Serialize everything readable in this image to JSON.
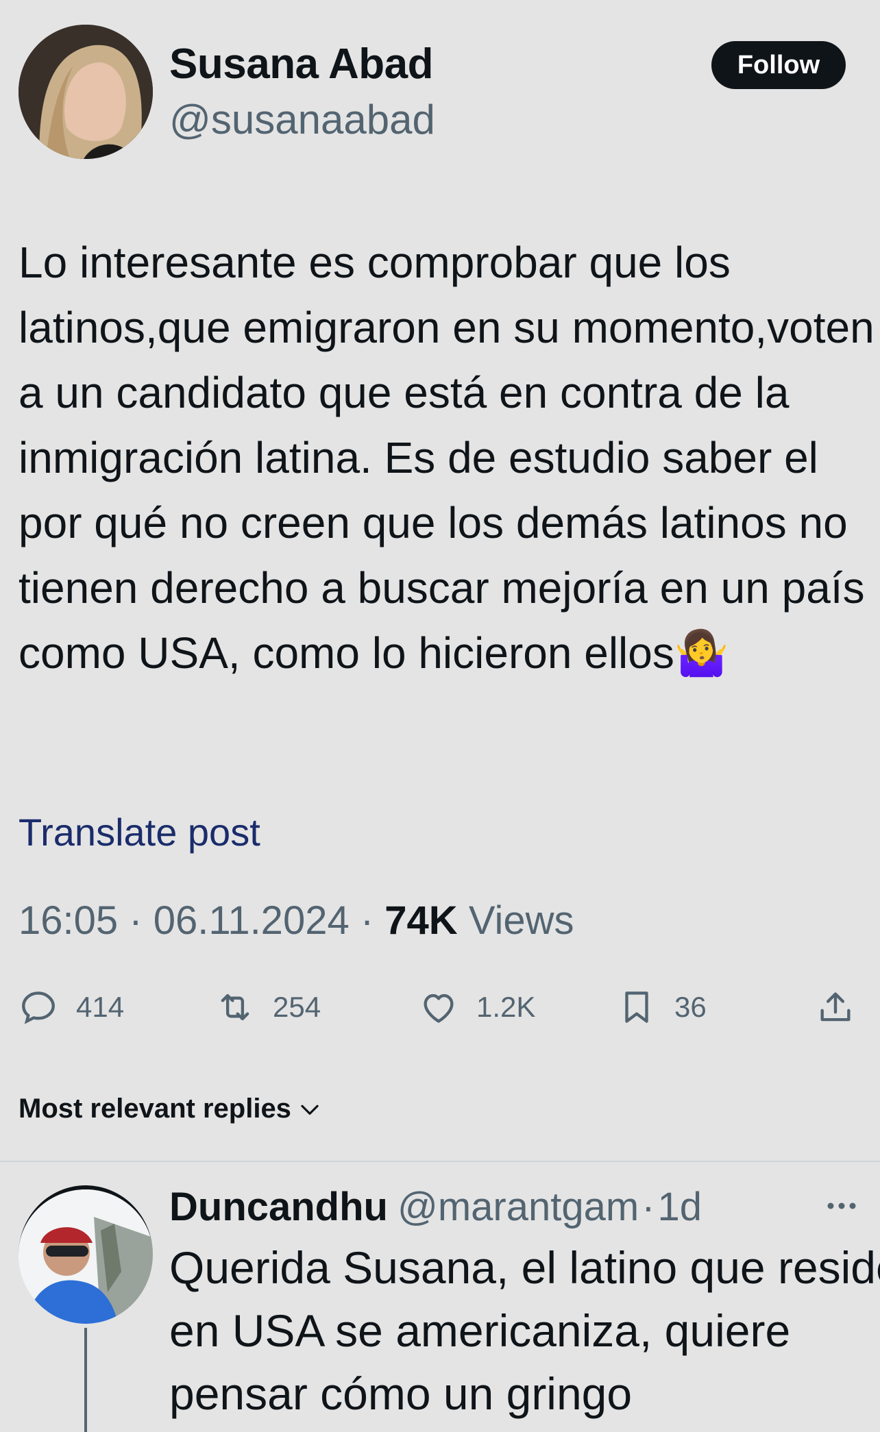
{
  "post": {
    "author": {
      "display_name": "Susana Abad",
      "handle": "@susanaabad",
      "avatar_icon": "profile-photo"
    },
    "follow_label": "Follow",
    "text": "Lo interesante es comprobar que los latinos,que emigraron en su momento,voten a un candidato que está en contra de la inmigración latina. Es de estudio saber el por qué no creen que los demás latinos no tienen derecho a buscar mejoría en un país como USA, como lo hicieron ellos🤷‍♀️",
    "translate_label": "Translate post",
    "time": "16:05",
    "date": "06.11.2024",
    "separator": "·",
    "views_count": "74K",
    "views_label": "Views",
    "actions": {
      "replies": {
        "count": "414",
        "icon": "reply-icon"
      },
      "reposts": {
        "count": "254",
        "icon": "repost-icon"
      },
      "likes": {
        "count": "1.2K",
        "icon": "heart-icon"
      },
      "bookmarks": {
        "count": "36",
        "icon": "bookmark-icon"
      },
      "share": {
        "icon": "share-icon"
      }
    }
  },
  "replies_section": {
    "sort_label": "Most relevant replies",
    "sort_icon": "chevron-down-icon"
  },
  "reply": {
    "display_name": "Duncandhu",
    "handle": "@marantgam",
    "separator": "·",
    "age": "1d",
    "more_icon": "more-icon",
    "text": "Querida Susana, el latino que reside en USA se americaniza, quiere pensar cómo un gringo"
  },
  "colors": {
    "background": "#e4e4e4",
    "text": "#0f1419",
    "secondary": "#536471",
    "link": "#1a2c6b"
  }
}
